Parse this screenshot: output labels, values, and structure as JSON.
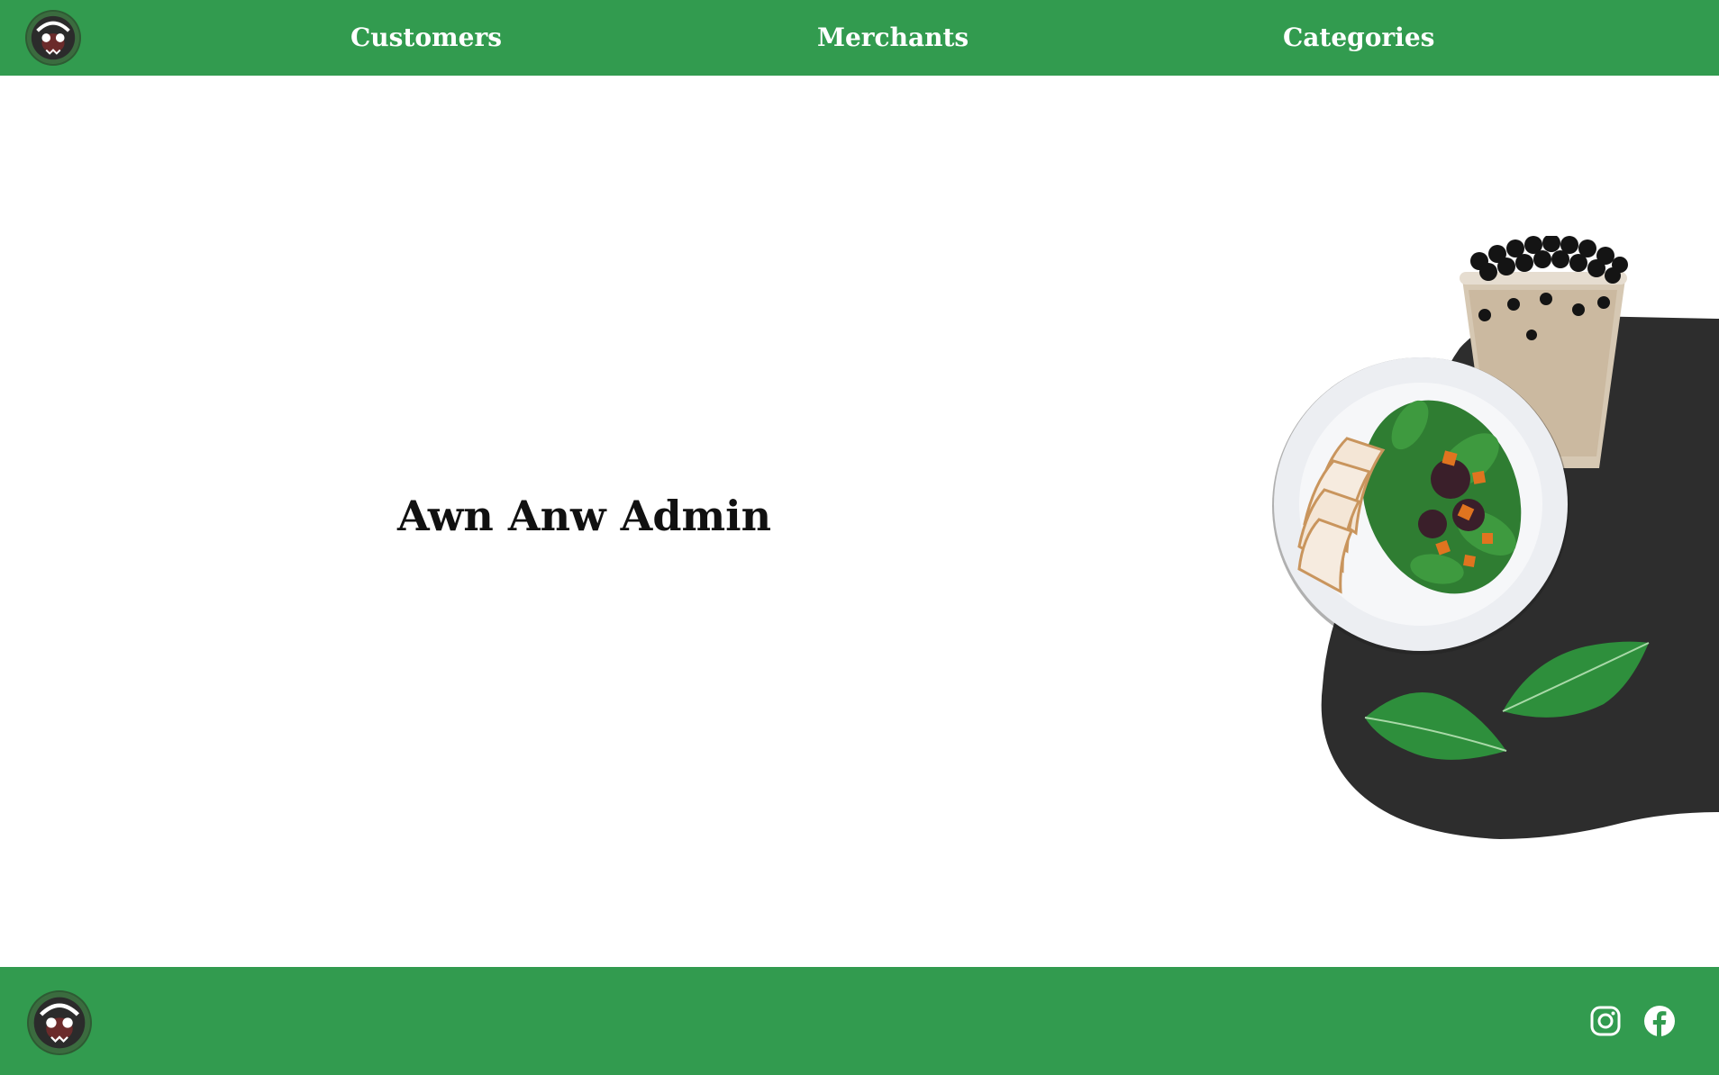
{
  "header": {
    "logo_icon": "awn-anw-logo-icon",
    "nav": [
      {
        "label": "Customers"
      },
      {
        "label": "Merchants"
      },
      {
        "label": "Categories"
      }
    ]
  },
  "hero": {
    "title": "Awn Anw Admin",
    "illustration": "food-plate-boba-tea-leaves"
  },
  "footer": {
    "logo_icon": "awn-anw-logo-icon",
    "social": [
      {
        "icon": "instagram-icon"
      },
      {
        "icon": "facebook-icon"
      }
    ]
  },
  "colors": {
    "brand_green": "#329b4f",
    "blob_dark": "#2d2d2d",
    "text_dark": "#111111",
    "white": "#ffffff"
  }
}
